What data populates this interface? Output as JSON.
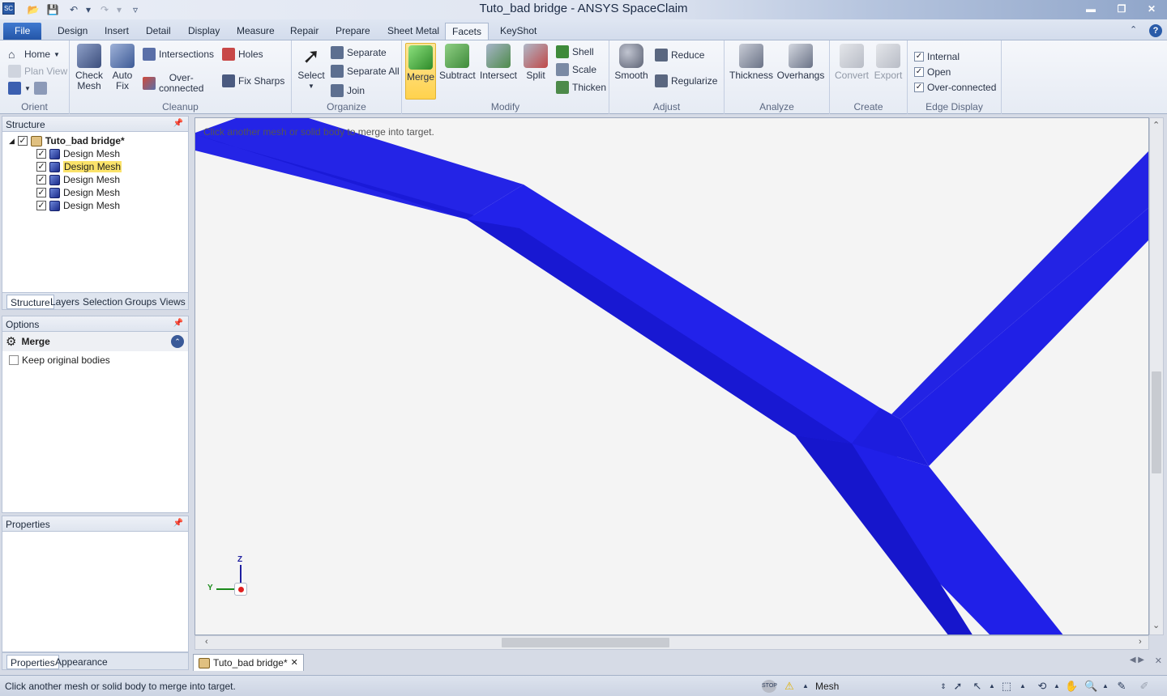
{
  "window": {
    "title": "Tuto_bad bridge - ANSYS SpaceClaim",
    "app_icon": "SC"
  },
  "ribbon_tabs": [
    "File",
    "Design",
    "Insert",
    "Detail",
    "Display",
    "Measure",
    "Repair",
    "Prepare",
    "Sheet Metal",
    "Facets",
    "KeyShot"
  ],
  "active_tab": "Facets",
  "ribbon": {
    "orient": {
      "label": "Orient",
      "home": "Home",
      "plan_view": "Plan View"
    },
    "cleanup": {
      "label": "Cleanup",
      "check_mesh": "Check\nMesh",
      "auto_fix": "Auto\nFix",
      "intersections": "Intersections",
      "over_connected": "Over-\nconnected",
      "holes": "Holes",
      "fix_sharps": "Fix Sharps"
    },
    "organize": {
      "label": "Organize",
      "select": "Select",
      "separate": "Separate",
      "separate_all": "Separate All",
      "join": "Join"
    },
    "modify": {
      "label": "Modify",
      "merge": "Merge",
      "subtract": "Subtract",
      "intersect": "Intersect",
      "split": "Split",
      "shell": "Shell",
      "scale": "Scale",
      "thicken": "Thicken"
    },
    "adjust": {
      "label": "Adjust",
      "smooth": "Smooth",
      "reduce": "Reduce",
      "regularize": "Regularize"
    },
    "analyze": {
      "label": "Analyze",
      "thickness": "Thickness",
      "overhangs": "Overhangs"
    },
    "create": {
      "label": "Create",
      "convert": "Convert",
      "export": "Export"
    },
    "edge_display": {
      "label": "Edge Display",
      "internal": "Internal",
      "open": "Open",
      "over_connected": "Over-connected"
    }
  },
  "structure": {
    "header": "Structure",
    "root": "Tuto_bad bridge*",
    "items": [
      "Design Mesh",
      "Design Mesh",
      "Design Mesh",
      "Design Mesh",
      "Design Mesh"
    ],
    "tabs": [
      "Structure",
      "Layers",
      "Selection",
      "Groups",
      "Views"
    ]
  },
  "options": {
    "header": "Options",
    "tool": "Merge",
    "keep_original": "Keep original bodies"
  },
  "properties": {
    "header": "Properties",
    "tabs": [
      "Properties",
      "Appearance"
    ]
  },
  "viewport": {
    "hint": "Click another mesh or solid body to merge into target.",
    "triad": {
      "z": "Z",
      "y": "Y"
    },
    "mesh_color": "#1e1ee6"
  },
  "document_tab": "Tuto_bad bridge*",
  "status": {
    "message": "Click another mesh or solid body to merge into target.",
    "mode": "Mesh"
  }
}
